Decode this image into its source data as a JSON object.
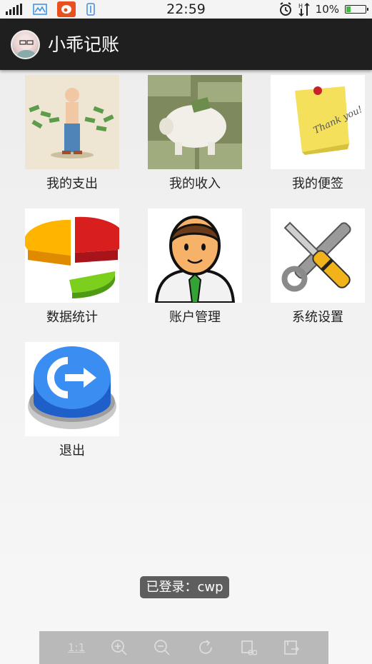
{
  "status_bar": {
    "time": "22:59",
    "battery_percent": "10%",
    "battery_level": 0.1,
    "icons": [
      "signal-icon",
      "gallery-icon",
      "weibo-icon",
      "usb-icon",
      "alarm-icon",
      "data-arrows-icon",
      "battery-icon"
    ]
  },
  "app_bar": {
    "title": "小乖记账"
  },
  "grid": {
    "items": [
      {
        "label": "我的支出",
        "icon": "expense-icon"
      },
      {
        "label": "我的收入",
        "icon": "income-icon"
      },
      {
        "label": "我的便签",
        "icon": "notes-icon"
      },
      {
        "label": "数据统计",
        "icon": "statistics-icon"
      },
      {
        "label": "账户管理",
        "icon": "account-icon"
      },
      {
        "label": "系统设置",
        "icon": "settings-icon"
      },
      {
        "label": "退出",
        "icon": "exit-icon"
      }
    ]
  },
  "toast": {
    "text": "已登录：cwp"
  },
  "zoom_toolbar": {
    "actual_size_label": "1:1",
    "buttons": [
      "actual-size-icon",
      "zoom-in-icon",
      "zoom-out-icon",
      "rotate-icon",
      "crop-icon",
      "save-icon"
    ]
  },
  "colors": {
    "app_bar_bg": "#1f1f1f",
    "toast_bg": "#5e5e5e",
    "toolbar_bg": "#b9b9b9"
  }
}
